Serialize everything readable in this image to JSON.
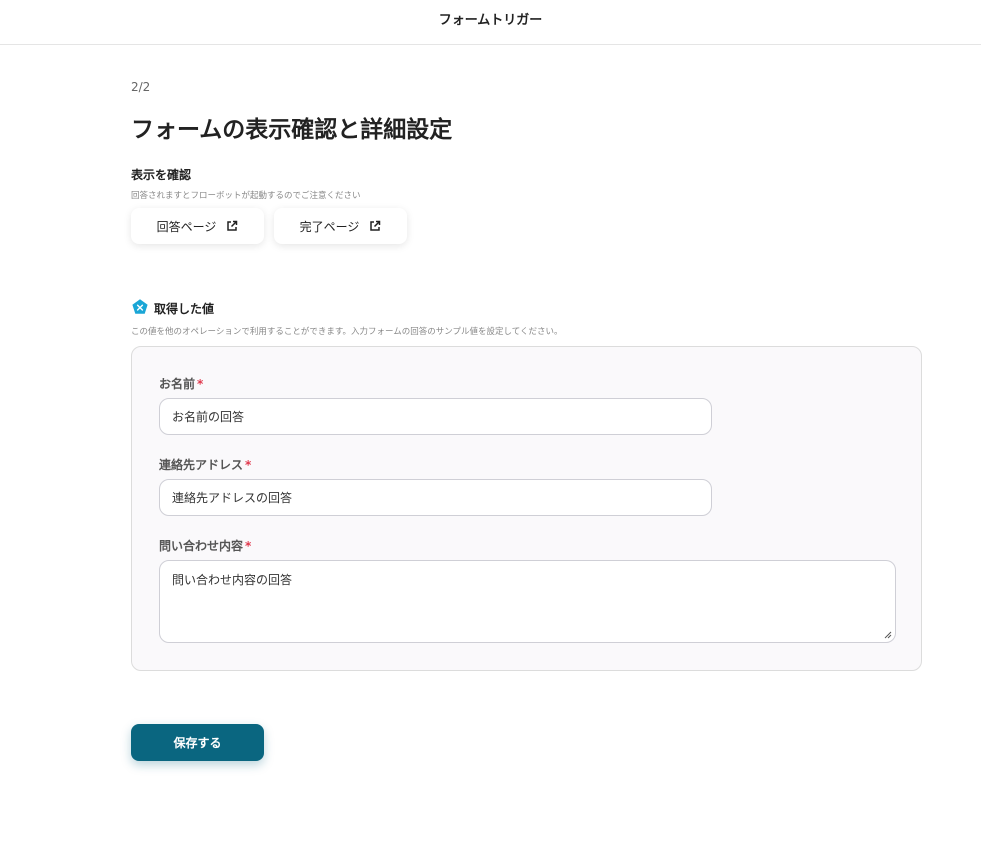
{
  "header": {
    "title": "フォームトリガー"
  },
  "page": {
    "step": "2/2",
    "title": "フォームの表示確認と詳細設定"
  },
  "preview": {
    "title": "表示を確認",
    "note": "回答されますとフローボットが起動するのでご注意ください",
    "buttons": [
      {
        "label": "回答ページ",
        "icon": "external-link-icon"
      },
      {
        "label": "完了ページ",
        "icon": "external-link-icon"
      }
    ]
  },
  "values": {
    "icon": "pentagon-x-icon",
    "title": "取得した値",
    "note": "この値を他のオペレーションで利用することができます。入力フォームの回答のサンプル値を設定してください。",
    "fields": [
      {
        "label": "お名前",
        "required_mark": "*",
        "value": "お名前の回答"
      },
      {
        "label": "連絡先アドレス",
        "required_mark": "*",
        "value": "連絡先アドレスの回答"
      },
      {
        "label": "問い合わせ内容",
        "required_mark": "*",
        "value": "問い合わせ内容の回答"
      }
    ]
  },
  "actions": {
    "save_label": "保存する"
  },
  "colors": {
    "primary": "#0a6680",
    "required": "#e0394d",
    "icon_accent": "#1aa6d6"
  }
}
